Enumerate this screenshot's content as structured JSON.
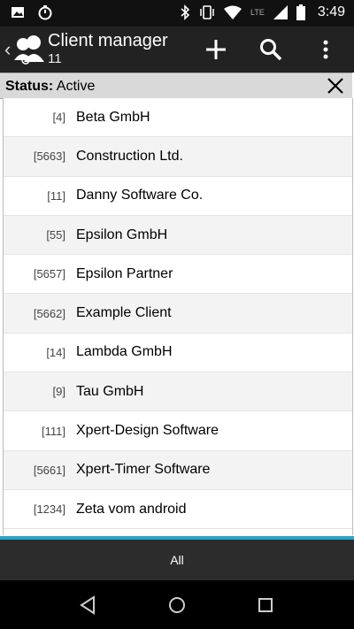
{
  "status_bar": {
    "time": "3:49",
    "network": "LTE",
    "icons": [
      "image-icon",
      "timer-icon",
      "bluetooth-icon",
      "vibrate-icon",
      "wifi-icon",
      "signal-icon",
      "battery-icon"
    ]
  },
  "action_bar": {
    "title": "Client manager",
    "subtitle": "11",
    "actions": [
      "add-icon",
      "search-icon",
      "overflow-menu-icon"
    ]
  },
  "filter": {
    "label": "Status:",
    "value": "Active"
  },
  "clients": [
    {
      "id": "[4]",
      "name": "Beta GmbH"
    },
    {
      "id": "[5663]",
      "name": "Construction Ltd."
    },
    {
      "id": "[11]",
      "name": "Danny Software Co."
    },
    {
      "id": "[55]",
      "name": "Epsilon GmbH"
    },
    {
      "id": "[5657]",
      "name": "Epsilon Partner"
    },
    {
      "id": "[5662]",
      "name": "Example Client"
    },
    {
      "id": "[14]",
      "name": "Lambda GmbH"
    },
    {
      "id": "[9]",
      "name": "Tau GmbH"
    },
    {
      "id": "[111]",
      "name": "Xpert-Design Software"
    },
    {
      "id": "[5661]",
      "name": "Xpert-Timer Software"
    },
    {
      "id": "[1234]",
      "name": "Zeta vom android"
    }
  ],
  "bottom_tab": {
    "label": "All"
  },
  "colors": {
    "accent": "#2aa3c6",
    "action_bar": "#222222",
    "status_bar": "#111111"
  }
}
